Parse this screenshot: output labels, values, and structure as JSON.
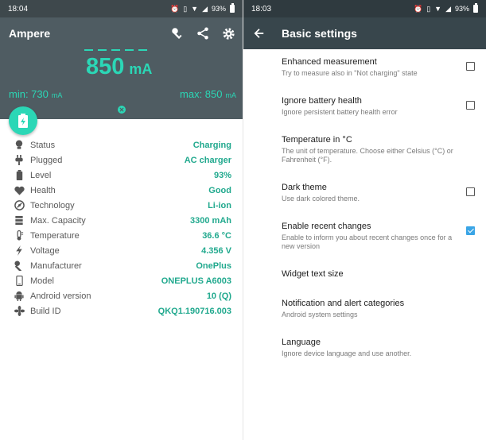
{
  "left": {
    "status_bar": {
      "time": "18:04",
      "battery": "93%"
    },
    "app_title": "Ampere",
    "current": {
      "value": "850",
      "unit": "mA"
    },
    "min": {
      "label": "min: 730",
      "unit": "mA"
    },
    "max": {
      "label": "max: 850",
      "unit": "mA"
    },
    "info": [
      {
        "icon": "bulb-icon",
        "label": "Status",
        "value": "Charging"
      },
      {
        "icon": "plug-icon",
        "label": "Plugged",
        "value": "AC charger"
      },
      {
        "icon": "battery-icon",
        "label": "Level",
        "value": "93%"
      },
      {
        "icon": "heart-icon",
        "label": "Health",
        "value": "Good"
      },
      {
        "icon": "atom-icon",
        "label": "Technology",
        "value": "Li-ion"
      },
      {
        "icon": "stack-icon",
        "label": "Max. Capacity",
        "value": "3300 mAh"
      },
      {
        "icon": "thermometer-icon",
        "label": "Temperature",
        "value": "36.6 °C"
      },
      {
        "icon": "bolt-icon",
        "label": "Voltage",
        "value": "4.356 V"
      },
      {
        "icon": "wrench-icon",
        "label": "Manufacturer",
        "value": "OnePlus"
      },
      {
        "icon": "phone-icon",
        "label": "Model",
        "value": "ONEPLUS A6003"
      },
      {
        "icon": "android-icon",
        "label": "Android version",
        "value": "10 (Q)"
      },
      {
        "icon": "fan-icon",
        "label": "Build ID",
        "value": "QKQ1.190716.003"
      }
    ],
    "colors": {
      "accent": "#2bd7b6",
      "header": "#4f5c62",
      "value_text": "#21a98e"
    }
  },
  "right": {
    "status_bar": {
      "time": "18:03",
      "battery": "93%"
    },
    "title": "Basic settings",
    "settings": [
      {
        "title": "Enhanced measurement",
        "subtitle": "Try to measure also in \"Not charging\" state",
        "checkbox": true,
        "checked": false
      },
      {
        "title": "Ignore battery health",
        "subtitle": "Ignore persistent battery health error",
        "checkbox": true,
        "checked": false
      },
      {
        "title": "Temperature in °C",
        "subtitle": "The unit of temperature. Choose either Celsius (°C) or Fahrenheit (°F).",
        "checkbox": false
      },
      {
        "title": "Dark theme",
        "subtitle": "Use dark colored theme.",
        "checkbox": true,
        "checked": false
      },
      {
        "title": "Enable recent changes",
        "subtitle": "Enable to inform you about recent changes once for a new version",
        "checkbox": true,
        "checked": true
      },
      {
        "title": "Widget text size",
        "subtitle": "",
        "checkbox": false
      },
      {
        "title": "Notification and alert categories",
        "subtitle": "Android system settings",
        "checkbox": false
      },
      {
        "title": "Language",
        "subtitle": "Ignore device language and use another.",
        "checkbox": false
      }
    ],
    "colors": {
      "toolbar": "#38464c",
      "check": "#3aa5e6"
    }
  }
}
